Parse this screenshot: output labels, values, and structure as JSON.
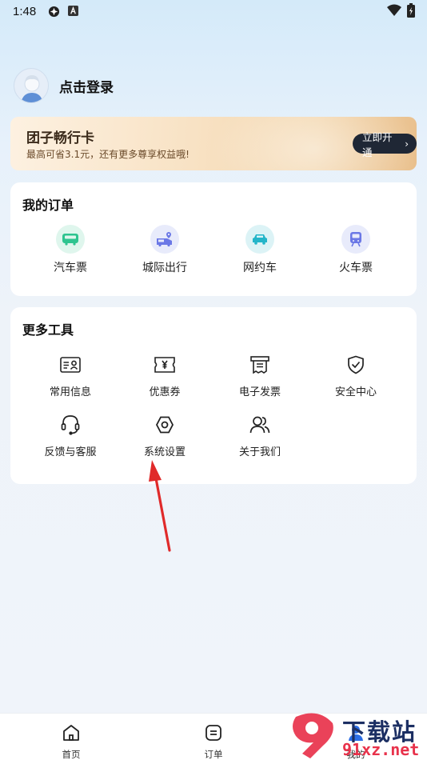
{
  "status_bar": {
    "time": "1:48"
  },
  "profile": {
    "login_label": "点击登录"
  },
  "member_card": {
    "title": "团子畅行卡",
    "subtitle": "最高可省3.1元，还有更多尊享权益哦!",
    "button_label": "立即开通"
  },
  "orders": {
    "title": "我的订单",
    "items": [
      {
        "label": "汽车票",
        "icon": "bus-icon",
        "color": "#2ec48f"
      },
      {
        "label": "城际出行",
        "icon": "van-location-icon",
        "color": "#6b78e6"
      },
      {
        "label": "网约车",
        "icon": "car-icon",
        "color": "#23b5c9"
      },
      {
        "label": "火车票",
        "icon": "train-icon",
        "color": "#6b78e6"
      }
    ]
  },
  "tools": {
    "title": "更多工具",
    "items": [
      {
        "label": "常用信息",
        "icon": "id-card-icon"
      },
      {
        "label": "优惠券",
        "icon": "coupon-icon"
      },
      {
        "label": "电子发票",
        "icon": "invoice-icon"
      },
      {
        "label": "安全中心",
        "icon": "shield-check-icon"
      },
      {
        "label": "反馈与客服",
        "icon": "headset-icon"
      },
      {
        "label": "系统设置",
        "icon": "settings-icon"
      },
      {
        "label": "关于我们",
        "icon": "users-icon"
      }
    ]
  },
  "bottom_nav": {
    "items": [
      {
        "label": "首页",
        "icon": "home-icon"
      },
      {
        "label": "订单",
        "icon": "order-icon"
      },
      {
        "label": "我的",
        "icon": "profile-icon"
      }
    ]
  },
  "watermark": {
    "line1": "下载站",
    "line2": "91xz.net"
  },
  "colors": {
    "accent_red": "#e8324b",
    "nav_dark": "#1f2735"
  }
}
